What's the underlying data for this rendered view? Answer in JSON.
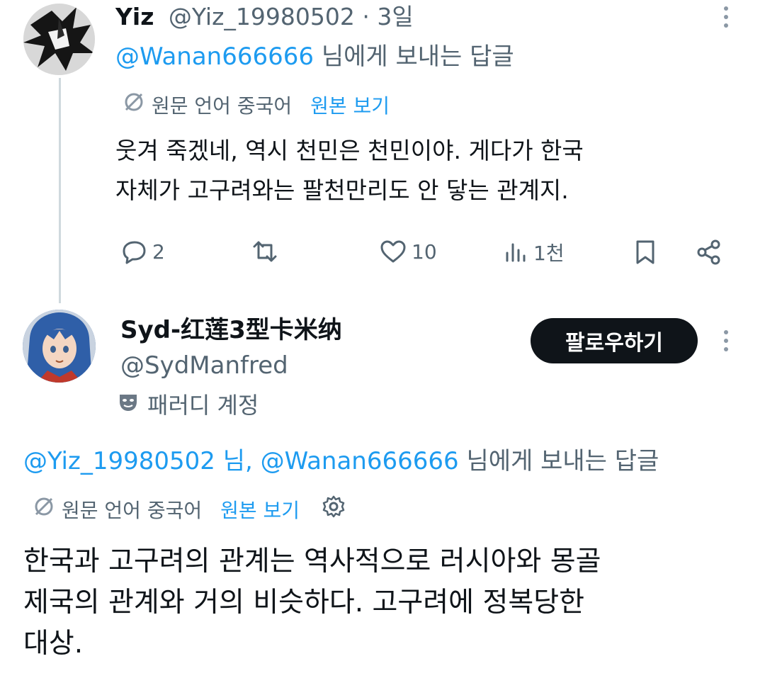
{
  "tweet1": {
    "name": "Yiz",
    "handle": "@Yiz_19980502",
    "time": "· 3일",
    "reply_handle": "@Wanan666666",
    "reply_suffix": "님에게 보내는 답글",
    "translate_label": "원문 언어 중국어",
    "show_original": "원본 보기",
    "body_line1": "웃겨 죽겠네, 역시 천민은 천민이야. 게다가 한국",
    "body_line2": "자체가 고구려와는 팔천만리도 안 닿는 관계지.",
    "replies": "2",
    "retweets": "",
    "likes": "10",
    "views": "1천"
  },
  "tweet2": {
    "name": "Syd-红莲3型卡米纳",
    "handle": "@SydManfred",
    "parody_label": "패러디 계정",
    "follow_label": "팔로우하기",
    "reply_handle1": "@Yiz_19980502",
    "reply_mid": "님,",
    "reply_handle2": "@Wanan666666",
    "reply_suffix": "님에게 보내는 답글",
    "translate_label": "원문 언어 중국어",
    "show_original": "원본 보기",
    "body_line1": "한국과 고구려의 관계는 역사적으로 러시아와 몽골",
    "body_line2": "제국의 관계와 거의 비슷하다. 고구려에 정복당한",
    "body_line3": "대상."
  },
  "colors": {
    "accent": "#1d9bf0",
    "secondary_text": "#536471",
    "primary_text": "#0f1419",
    "follow_button_bg": "#0f1419"
  }
}
